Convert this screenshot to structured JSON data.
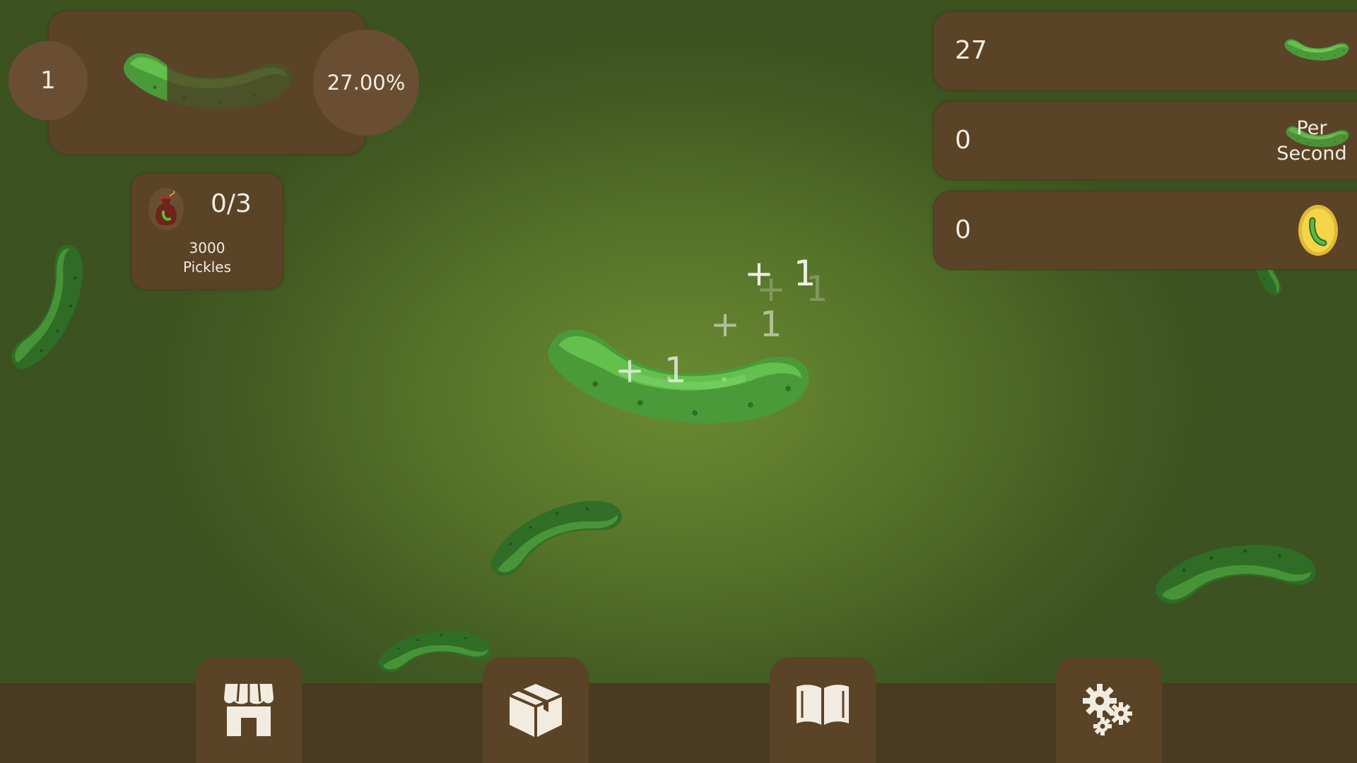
{
  "level": {
    "value": "1",
    "progress_label": "27.00%",
    "progress_fraction": 0.27
  },
  "goal": {
    "progress": "0/3",
    "amount": "3000",
    "unit": "Pickles",
    "icon": "pickle-bag-icon"
  },
  "stats": {
    "total": {
      "value": "27",
      "icon": "pickle-icon"
    },
    "rate": {
      "value": "0",
      "label_line1": "Per",
      "label_line2": "Second",
      "icon": "pickle-icon"
    },
    "coins": {
      "value": "0",
      "icon": "pickle-coin-icon"
    }
  },
  "floating_gains": [
    "+ 1",
    "+ 1",
    "+ 1",
    "+ 1"
  ],
  "nav": [
    {
      "name": "shop",
      "icon": "storefront-icon"
    },
    {
      "name": "inventory",
      "icon": "box-icon"
    },
    {
      "name": "book",
      "icon": "open-book-icon"
    },
    {
      "name": "settings",
      "icon": "gears-icon"
    }
  ],
  "colors": {
    "panel": "#5b4328",
    "pickle": "#5cb947",
    "background": "#56742a",
    "bottom_bar": "#4a3a22"
  }
}
